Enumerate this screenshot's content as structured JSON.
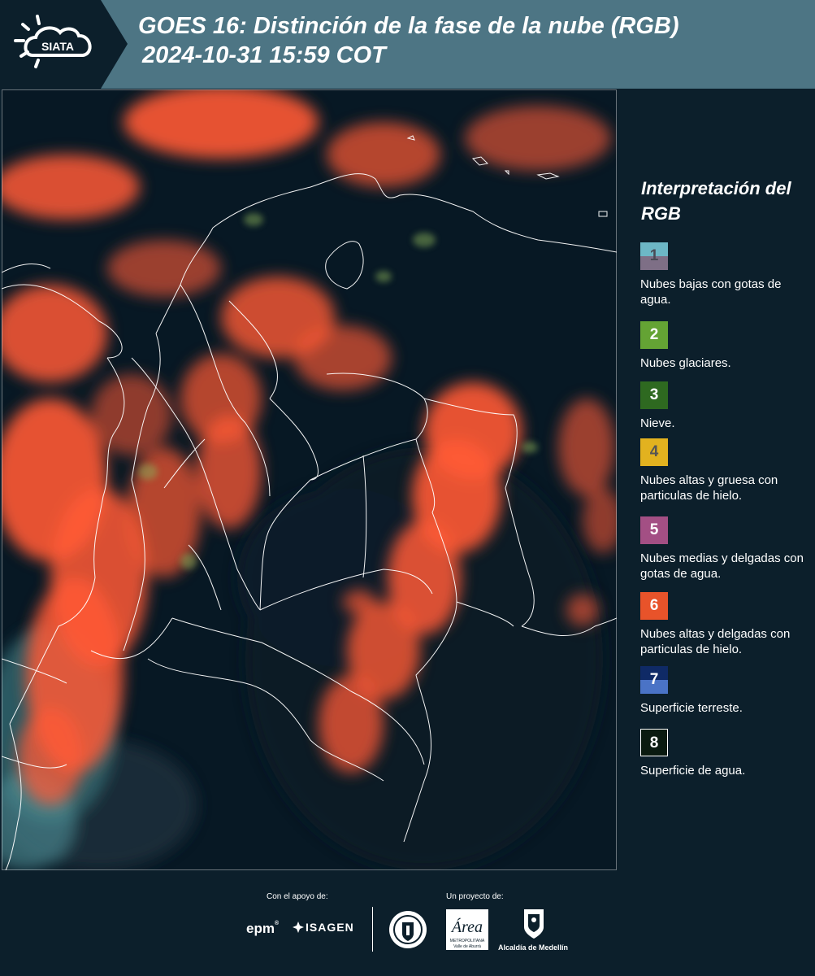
{
  "header": {
    "logo_text": "SIATA",
    "title_line1": "GOES 16: Distinción de la fase de la nube (RGB)",
    "title_line2": "2024-10-31 15:59 COT"
  },
  "legend": {
    "title": "Interpretación del RGB",
    "items": [
      {
        "num": "1",
        "label": "Nubes bajas con gotas de agua.",
        "color_top": "#6db7c6",
        "color_bottom": "#7e6f86",
        "num_color": "#4a4a55"
      },
      {
        "num": "2",
        "label": "Nubes glaciares.",
        "color_top": "#64a334",
        "color_bottom": "#64a334",
        "num_color": "#ffffff"
      },
      {
        "num": "3",
        "label": "Nieve.",
        "color_top": "#2e6920",
        "color_bottom": "#2e6920",
        "num_color": "#ffffff"
      },
      {
        "num": "4",
        "label": "Nubes altas y gruesa con particulas de hielo.",
        "color_top": "#e2b21f",
        "color_bottom": "#e2b21f",
        "num_color": "#555555"
      },
      {
        "num": "5",
        "label": "Nubes medias y delgadas con gotas de agua.",
        "color_top": "#a34f84",
        "color_bottom": "#a34f84",
        "num_color": "#ffffff"
      },
      {
        "num": "6",
        "label": "Nubes altas y delgadas con particulas de hielo.",
        "color_top": "#e8532a",
        "color_bottom": "#e8532a",
        "num_color": "#ffffff"
      },
      {
        "num": "7",
        "label": "Superficie terreste.",
        "color_top": "#0f2a66",
        "color_bottom": "#4a73c6",
        "num_color": "#ffffff"
      },
      {
        "num": "8",
        "label": "Superficie de agua.",
        "color_top": "#0a1a10",
        "color_bottom": "#0a1a10",
        "num_color": "#ffffff"
      }
    ]
  },
  "footer": {
    "support_label": "Con el apoyo de:",
    "project_label": "Un proyecto de:",
    "epm": "epm",
    "isagen": "ISAGEN",
    "area_word": "Área",
    "area_sub1": "METROPOLITANA",
    "area_sub2": "Valle de Aburrá",
    "alcaldia": "Alcaldía de Medellín"
  },
  "colors": {
    "header_bg": "#4d7584",
    "panel_bg": "#0c1f2b",
    "cloud_red": "#ff5a35"
  }
}
